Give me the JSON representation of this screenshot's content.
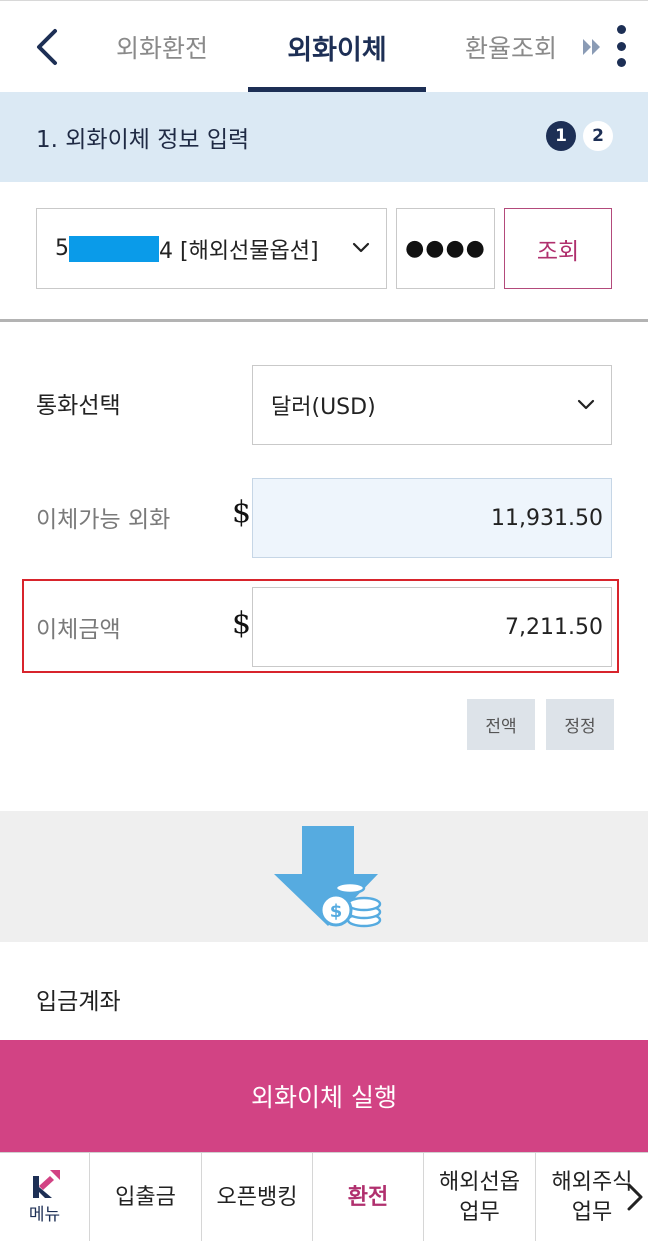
{
  "tabs": [
    {
      "label": "외화환전",
      "active": false
    },
    {
      "label": "외화이체",
      "active": true
    },
    {
      "label": "환율조회",
      "active": false
    }
  ],
  "step": {
    "title": "1. 외화이체 정보 입력",
    "numbers": [
      "1",
      "2"
    ],
    "current": 1
  },
  "account": {
    "prefix": "5",
    "suffix": "4 [해외선물옵션]",
    "password_mask": "●●●●",
    "query_label": "조회"
  },
  "form": {
    "currency_label": "통화선택",
    "currency_value": "달러(USD)",
    "available_label": "이체가능 외화",
    "available_value": "11,931.50",
    "amount_label": "이체금액",
    "amount_value": "7,211.50",
    "currency_symbol": "$",
    "full_amount_label": "전액",
    "correct_label": "정정"
  },
  "deposit": {
    "label": "입금계좌"
  },
  "execute_label": "외화이체 실행",
  "bottom_nav": {
    "menu_label": "메뉴",
    "items": [
      {
        "label": "입출금",
        "active": false
      },
      {
        "label": "오픈뱅킹",
        "active": false
      },
      {
        "label": "환전",
        "active": true
      },
      {
        "label": "해외선옵\n업무",
        "active": false
      },
      {
        "label": "해외주식\n업무",
        "active": false
      }
    ]
  },
  "colors": {
    "navy": "#1d2f55",
    "banner_bg": "#dbe9f4",
    "accent_pink": "#d24384",
    "highlight_red": "#d8242c",
    "mask_blue": "#0a9be9",
    "arrow_blue": "#56abe0"
  },
  "icons": {
    "back": "chevron-left-icon",
    "more": "more-vertical-icon",
    "tab_scroll": "double-chevron-right-icon",
    "select": "chevron-down-icon",
    "transfer": "arrow-down-coins-icon",
    "logo": "k-logo-icon",
    "nav_next": "chevron-right-icon"
  }
}
